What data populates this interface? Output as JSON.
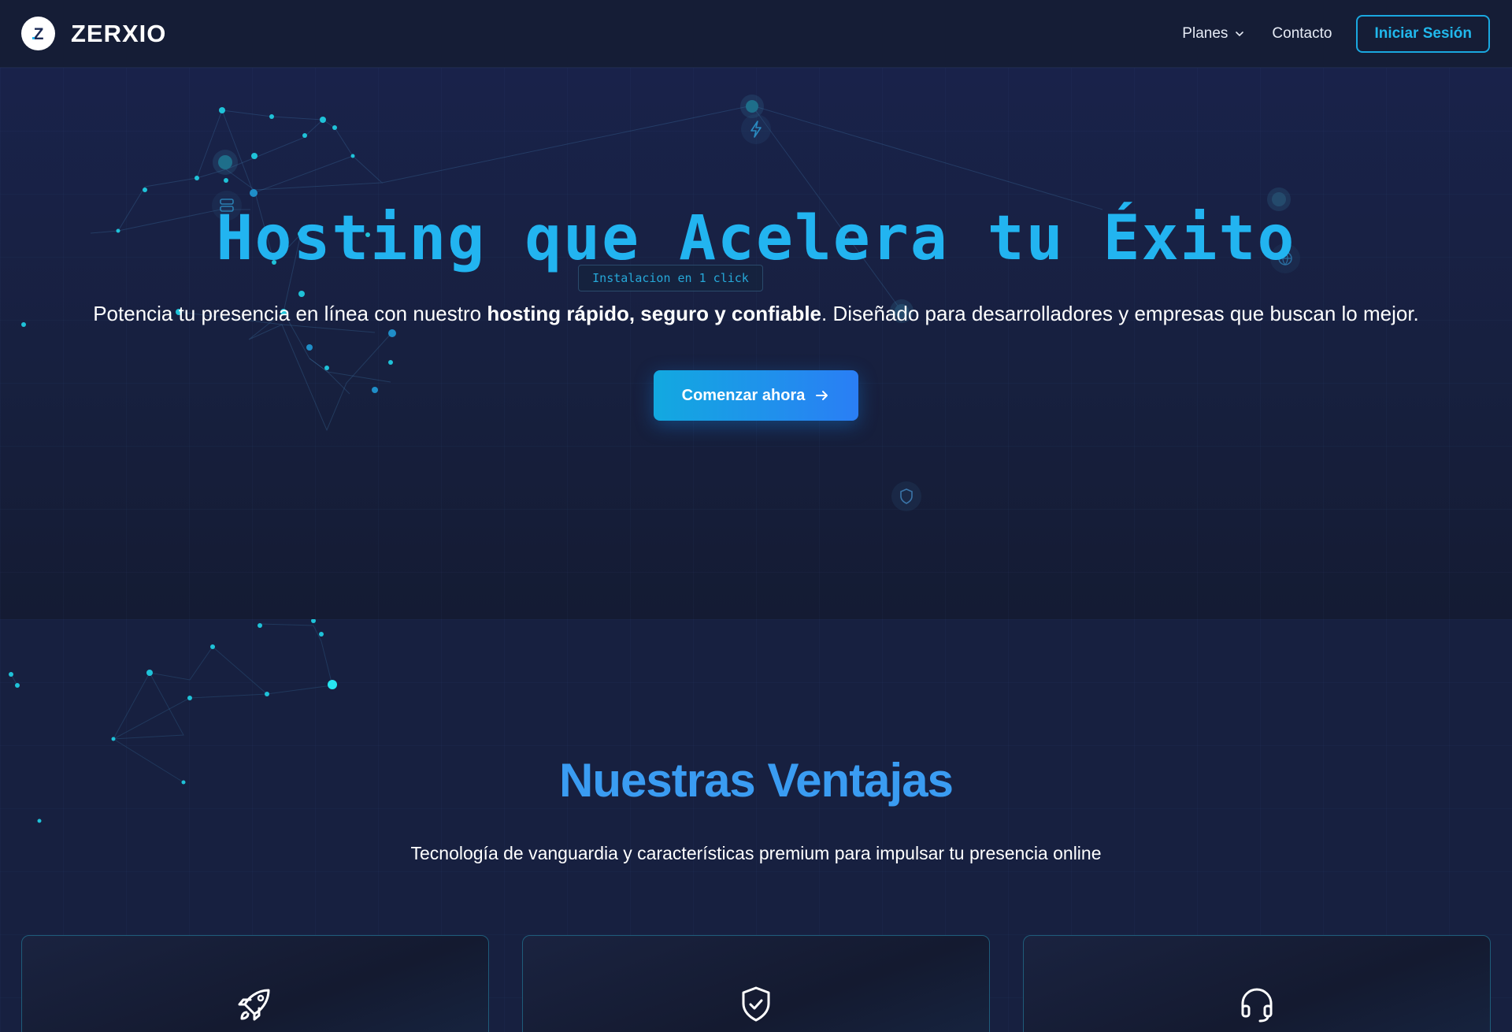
{
  "nav": {
    "brand": "ZERXIO",
    "logo_letter": "Z",
    "links": [
      {
        "label": "Planes",
        "has_dropdown": true
      },
      {
        "label": "Contacto",
        "has_dropdown": false
      }
    ],
    "login_label": "Iniciar Sesión"
  },
  "hero": {
    "title": "Hosting que Acelera tu Éxito",
    "badge": "Instalacion en 1 click",
    "subtitle_pre": "Potencia tu presencia en línea con nuestro ",
    "subtitle_bold": "hosting rápido, seguro y confiable",
    "subtitle_post": ". Diseñado para desarrolladores y empresas que buscan lo mejor.",
    "cta_label": "Comenzar ahora"
  },
  "features": {
    "title": "Nuestras Ventajas",
    "subtitle": "Tecnología de vanguardia y características premium para impulsar tu presencia online",
    "cards": [
      {
        "icon": "rocket-icon"
      },
      {
        "icon": "shield-check-icon"
      },
      {
        "icon": "headset-icon"
      }
    ]
  },
  "colors": {
    "accent": "#22b4f0",
    "cta_start": "#12a9e0",
    "cta_end": "#2a7ef5",
    "background": "#141b33"
  }
}
